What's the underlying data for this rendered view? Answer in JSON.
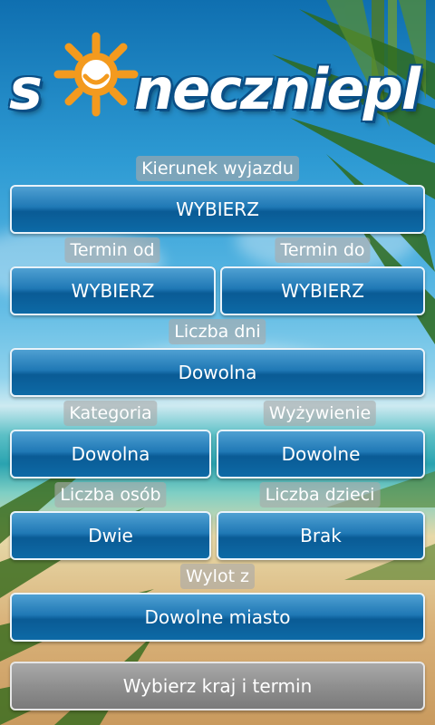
{
  "logo": {
    "text_left": "s",
    "text_right": "neczniepl",
    "full_name": "słonecznie.pl"
  },
  "fields": {
    "kierunek": {
      "label": "Kierunek wyjazdu",
      "value": "WYBIERZ"
    },
    "termin_od": {
      "label": "Termin od",
      "value": "WYBIERZ"
    },
    "termin_do": {
      "label": "Termin do",
      "value": "WYBIERZ"
    },
    "liczba_dni": {
      "label": "Liczba dni",
      "value": "Dowolna"
    },
    "kategoria": {
      "label": "Kategoria",
      "value": "Dowolna"
    },
    "wyzywienie": {
      "label": "Wyżywienie",
      "value": "Dowolne"
    },
    "liczba_osob": {
      "label": "Liczba osób",
      "value": "Dwie"
    },
    "liczba_dzieci": {
      "label": "Liczba dzieci",
      "value": "Brak"
    },
    "wylot": {
      "label": "Wylot z",
      "value": "Dowolne miasto"
    }
  },
  "actions": {
    "submit_label": "Wybierz kraj i termin"
  },
  "colors": {
    "button_blue": "#1f78b5",
    "label_bg": "#aaaaaa",
    "submit_gray": "#8f8f8f",
    "logo_orange": "#f39a1e",
    "logo_blue": "#0a4f86"
  }
}
